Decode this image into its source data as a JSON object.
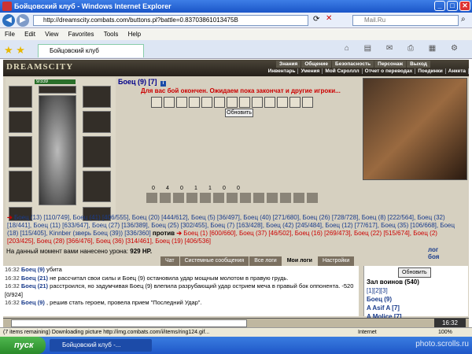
{
  "window": {
    "title": "Бойцовский клуб - Windows Internet Explorer",
    "min": "_",
    "max": "□",
    "close": "✕"
  },
  "address": {
    "url": "http://dreamscity.combats.com/buttons.pl?battle=0.83703861013475B",
    "search_placeholder": "Mail.Ru"
  },
  "menu": [
    "File",
    "Edit",
    "View",
    "Favorites",
    "Tools",
    "Help"
  ],
  "tab": {
    "label": "Бойцовский клуб"
  },
  "game": {
    "logo": "DREAMSCITY",
    "nav_top": [
      "Знания",
      "Общение",
      "Безопасность",
      "Персонаж",
      "Выход"
    ],
    "nav_sub": [
      "Инвентарь",
      "Умения",
      "Мой Скроллл",
      "Отчет о переводах",
      "Поединки",
      "Анкета"
    ],
    "hp": "9/339",
    "fighter_name": "Боец (9)",
    "fighter_level": "[7]",
    "message": "Для вас бой окончен. Ожидаем пока закончат и другие игроки...",
    "refresh_label": "Обновить",
    "tool_counts": [
      "0",
      "4",
      "0",
      "1",
      "1",
      "0",
      "0"
    ],
    "battle_team1": [
      "Боец (13) [110/749]",
      "Боец (41) [406/555]",
      "Боец (20) [444/612]",
      "Боец (5) [36/497]",
      "Боец (40) [271/680]",
      "Боец (26) [728/728]",
      "Боец (8) [222/564]",
      "Боец (32) [18/441]",
      "Боец (11) [633/647]",
      "Боец (27) [136/389]",
      "Боец (25) [302/455]",
      "Боец (7) [163/428]",
      "Боец (42) [245/484]",
      "Боец (12) [77/617]",
      "Боец (35) [106/668]",
      "Боец (18) [115/405]",
      "Kinnber (зверь Боец (39)) [336/360]"
    ],
    "vs": "против",
    "battle_team2": [
      "Боец (1) [600/660]",
      "Боец (37) [46/502]",
      "Боец (16) [269/473]",
      "Боец (22) [515/674]",
      "Боец (2) [203/425]",
      "Боец (28) [366/476]",
      "Боец (36) [314/461]",
      "Боец (19) [406/536]"
    ],
    "damage_label": "На данный момент вами нанесено урона:",
    "damage_value": "929 HP.",
    "battle_log_link": "лог боя",
    "chat_tabs": [
      "Чат",
      "Системные сообщения",
      "Все логи",
      "Мои логи",
      "Настройки"
    ],
    "chat_log": [
      {
        "time": "16:32",
        "who": "Боец (9)",
        "text": "убита"
      },
      {
        "time": "16:32",
        "who": "Боец (21)",
        "text": "не рассчитал свои силы и Боец (9) остановила удар мощным молотом в правую грудь."
      },
      {
        "time": "16:32",
        "who": "Боец (21)",
        "text": "расстроился, но задумчивая Боец (9) влепила разрубающий удар острием меча в правый бок оппонента. -520 [0/924]"
      },
      {
        "time": "16:32",
        "who": "Боец (9)",
        "text": ", решив стать героем, провела прием \"Последний Удар\"."
      }
    ],
    "online_update": "Обновить",
    "online_title": "Зал воинов (540)",
    "online_pages": "[1][2][3]",
    "online_users": [
      "Боец (9)",
      "A Asif A [7]",
      "A Molice [7]"
    ],
    "clock": "16:32"
  },
  "status": {
    "text": "(7 items remaining) Downloading picture http://img.combats.com/i/items/ring124.gif...",
    "zone": "Internet",
    "zoom": "100%"
  },
  "taskbar": {
    "start": "пуск",
    "task": "Бойцовский клуб -...",
    "watermark": "photo.scrolls.ru"
  }
}
